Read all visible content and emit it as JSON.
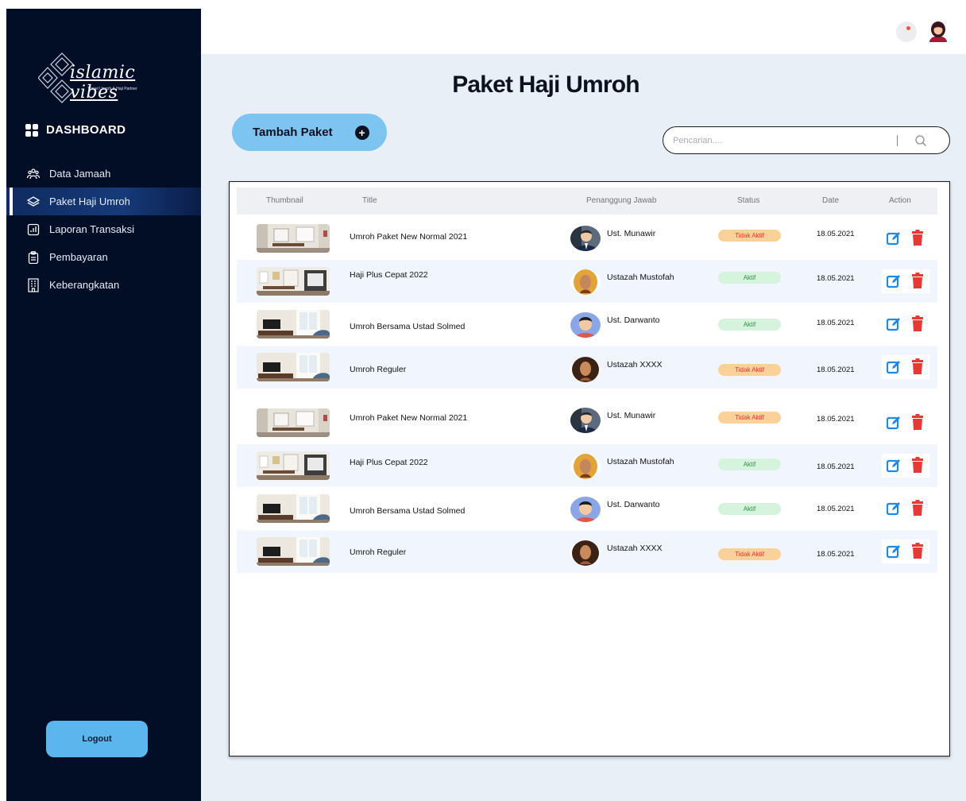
{
  "app": {
    "logo_text": "islamic vibes",
    "logo_sub": "Travel Umroh & Haji Partner"
  },
  "sidebar": {
    "dashboard_label": "DASHBOARD",
    "items": [
      {
        "label": "Data Jamaah",
        "icon": "users-icon"
      },
      {
        "label": "Paket Haji Umroh",
        "icon": "layers-icon",
        "active": true
      },
      {
        "label": "Laporan Transaksi",
        "icon": "chart-icon"
      },
      {
        "label": "Pembayaran",
        "icon": "clipboard-icon"
      },
      {
        "label": "Keberangkatan",
        "icon": "building-icon"
      }
    ],
    "logout_label": "Logout"
  },
  "main": {
    "title": "Paket Haji Umroh",
    "add_button_label": "Tambah Paket",
    "search_placeholder": "Pencarian...."
  },
  "table": {
    "headers": {
      "thumbnail": "Thumbnail",
      "title": "Title",
      "pj": "Penanggung Jawab",
      "status": "Status",
      "date": "Date",
      "action": "Action"
    },
    "rows": [
      {
        "title": "Umroh Paket New Normal 2021",
        "pj": "Ust. Munawir",
        "status": "Tidak Aktif",
        "date": "18.05.2021"
      },
      {
        "title": "Haji Plus Cepat 2022",
        "pj": "Ustazah Mustofah",
        "status": "Aktif",
        "date": "18.05.2021"
      },
      {
        "title": "Umroh Bersama Ustad Solmed",
        "pj": "Ust. Darwanto",
        "status": "Aktif",
        "date": "18.05.2021"
      },
      {
        "title": "Umroh Reguler",
        "pj": "Ustazah XXXX",
        "status": "Tidak Aktif",
        "date": "18.05.2021"
      },
      {
        "title": "Umroh Paket New Normal 2021",
        "pj": "Ust. Munawir",
        "status": "Tidak Aktif",
        "date": "18.05.2021"
      },
      {
        "title": "Haji Plus Cepat 2022",
        "pj": "Ustazah Mustofah",
        "status": "Aktif",
        "date": "18.05.2021"
      },
      {
        "title": "Umroh Bersama Ustad Solmed",
        "pj": "Ust. Darwanto",
        "status": "Aktif",
        "date": "18.05.2021"
      },
      {
        "title": "Umroh Reguler",
        "pj": "Ustazah XXXX",
        "status": "Tidak Aktif",
        "date": "18.05.2021"
      }
    ]
  },
  "colors": {
    "sidebar_bg": "#020d26",
    "accent": "#5cb6ee",
    "status_inactive_bg": "#fbd19a",
    "status_inactive_text": "#e8352a",
    "status_active_bg": "#d6f3dd",
    "edit_icon": "#1e88e5",
    "delete_icon": "#e53935"
  }
}
